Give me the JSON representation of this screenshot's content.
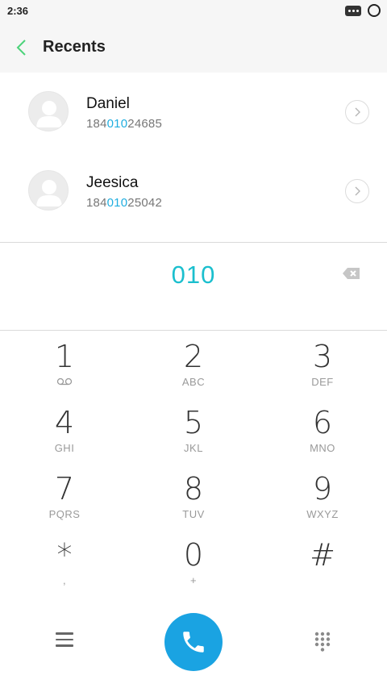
{
  "status_bar": {
    "time": "2:36"
  },
  "header": {
    "title": "Recents"
  },
  "recents": [
    {
      "name": "Daniel",
      "number_prefix": "184",
      "number_match": "010",
      "number_suffix": "24685"
    },
    {
      "name": "Jeesica",
      "number_prefix": "184",
      "number_match": "010",
      "number_suffix": "25042"
    }
  ],
  "dialer": {
    "typed_number": "010"
  },
  "keypad": [
    {
      "digit": "1",
      "letters": ""
    },
    {
      "digit": "2",
      "letters": "ABC"
    },
    {
      "digit": "3",
      "letters": "DEF"
    },
    {
      "digit": "4",
      "letters": "GHI"
    },
    {
      "digit": "5",
      "letters": "JKL"
    },
    {
      "digit": "6",
      "letters": "MNO"
    },
    {
      "digit": "7",
      "letters": "PQRS"
    },
    {
      "digit": "8",
      "letters": "TUV"
    },
    {
      "digit": "9",
      "letters": "WXYZ"
    },
    {
      "digit": "*",
      "letters": ","
    },
    {
      "digit": "0",
      "letters": "+"
    },
    {
      "digit": "#",
      "letters": ""
    }
  ],
  "colors": {
    "accent": "#1bbfce",
    "call_button": "#1aa3e2",
    "match_highlight": "#20aee0",
    "back_arrow": "#4cd37a"
  },
  "icons": {
    "back": "chevron-left-icon",
    "detail": "chevron-right-icon",
    "backspace": "backspace-icon",
    "voicemail": "voicemail-icon",
    "menu": "menu-icon",
    "call": "phone-icon",
    "dialpad": "dialpad-icon"
  }
}
